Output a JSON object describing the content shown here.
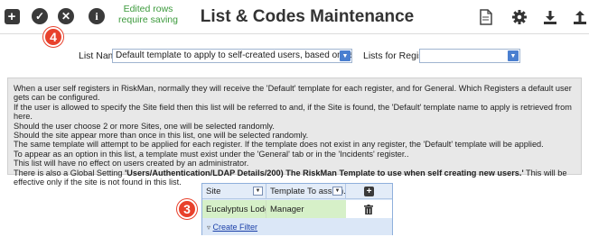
{
  "toolbar": {
    "icons": [
      "add-icon",
      "check-icon",
      "close-icon",
      "info-icon"
    ],
    "edited_line1": "Edited rows",
    "edited_line2": "require saving",
    "title": "List & Codes Maintenance",
    "right_icons": [
      "document-icon",
      "gear-icon",
      "download-icon",
      "upload-icon"
    ]
  },
  "badges": {
    "top": "4",
    "grid": "3"
  },
  "list_row": {
    "list_name_label": "List Name",
    "list_name_value": "Default template to apply to self-created users, based on selected Site.",
    "register_label": "Lists for Register",
    "register_value": ""
  },
  "info": {
    "lines": [
      "When a user self registers in RiskMan, normally they will receive the 'Default' template for each register, and for General. Which Registers a default user gets can be configured.",
      "If the user is allowed to specify the Site field then this list will be referred to and, if the Site is found, the 'Default' template name to apply is retrieved from here.",
      "Should the user choose 2 or more Sites, one will be selected randomly.",
      "Should the site appear more than once in this list, one will be selected randomly.",
      "The same template will attempt to be applied for each register. If the template does not exist in any register, the 'Default' template will be applied.",
      "To appear as an option in this list, a template must exist under the 'General' tab or in the 'Incidents' register..",
      "This list will have no effect on users created by an administrator."
    ],
    "global_prefix": "There is also a Global Setting ",
    "global_bold": "'Users/Authentication/LDAP Details/200) The RiskMan Template to use when self creating new users.'",
    "global_suffix": " This will be effective only if the site is not found in this list."
  },
  "grid": {
    "columns": [
      "Site",
      "Template To assign..."
    ],
    "rows": [
      {
        "site": "Eucalyptus Lodge",
        "template": "Manager"
      }
    ],
    "create_filter": "Create Filter"
  }
}
